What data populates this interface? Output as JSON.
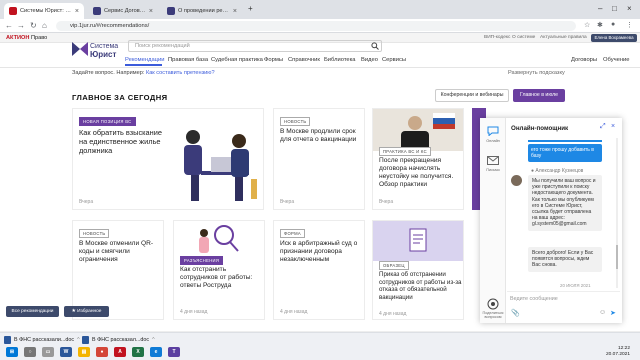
{
  "browser": {
    "tabs": [
      {
        "title": "Системы Юрист: ВИП-кодекс",
        "color": "#c1121f"
      },
      {
        "title": "Сервис Договоры",
        "color": "#3b3b7a"
      },
      {
        "title": "О проведении реки ерундиг...",
        "color": "#3b3b7a"
      }
    ],
    "url": "vip.1jur.ru/#/recommendations/"
  },
  "site_strip": {
    "logo_red": "АКТИОН",
    "logo_dark": "Право",
    "links": [
      "ВИП-кодекс",
      "О системе",
      "Актуальные правила"
    ],
    "account_button": "Елена Вохрамеева"
  },
  "header": {
    "logo_line1": "Система",
    "logo_line2": "Юрист",
    "search_placeholder": "Поиск рекомендаций",
    "menu": [
      "Рекомендации",
      "Правовая база",
      "Судебная практика",
      "Формы",
      "Справочник",
      "Библиотека",
      "Видео",
      "Сервисы"
    ],
    "menu_right": [
      "Договоры",
      "Обучение"
    ],
    "ask_prefix": "Задайте вопрос. Например:",
    "ask_link": "Как составить претензию?",
    "expand_hint": "Развернуть подсказку"
  },
  "main": {
    "heading": "ГЛАВНОЕ ЗА СЕГОДНЯ",
    "btn_conferences": "Конференции и вебинары",
    "btn_main_july": "Главное в июле",
    "cards": [
      {
        "tag": "НОВАЯ ПОЗИЦИЯ ВС",
        "title": "Как обратить взыскание на единственное жилье должника",
        "date": "Вчера"
      },
      {
        "tag": "НОВОСТЬ",
        "title": "В Москве продлили срок для отчета о вакцинации",
        "date": "Вчера"
      },
      {
        "tag": "ПРАКТИКА ВС И КС",
        "title": "После прекращения договора начислять неустойку не получится. Обзор практики",
        "date": "Вчера"
      },
      {
        "tag": "НОВОСТЬ",
        "title": "В Москве отменили QR-коды и смягчили ограничения",
        "date": ""
      },
      {
        "tag": "РАЗЪЯСНЕНИЯ",
        "title": "Как отстранить сотрудников от работы: ответы Роструда",
        "date": "4 дня назад"
      },
      {
        "tag": "ФОРМА",
        "title": "Иск в арбитражный суд о признании договора незаключенным",
        "date": "4 дня назад"
      },
      {
        "tag": "ОБРАЗЕЦ",
        "title": "Приказ об отстранении сотрудников от работы из-за отказа от обязательной вакцинации",
        "date": "4 дня назад"
      }
    ],
    "btn_recommendations": "Все рекомендации",
    "btn_favorites": "Избранное"
  },
  "chat": {
    "title": "Онлайн-помощник",
    "side_labels": [
      "Онлайн",
      "Письмо",
      "Поделиться вопросом"
    ],
    "user_message": "его тоже прошу добавить в базу",
    "operator_name": "Александр Кузнецов",
    "operator_message": "Мы получили ваш вопрос и уже приступили к поиску недостающего документа. Как только мы опубликуем его в Системе Юрист, ссылка будет отправлена на ваш адрес: gl.system05@gmail.com",
    "operator_message2": "Всего доброго! Если у Вас появятся вопросы, ждем Вас снова.",
    "date": "20 ИЮЛЯ 2021",
    "input_placeholder": "Ведите сообщение"
  },
  "taskbar": {
    "downloads": [
      "В ФНС рассказали...doc",
      "В ФНС рассказал...doc"
    ],
    "time": "12:22",
    "date": "20.07.2021"
  },
  "colors": {
    "accent": "#6a3fa0",
    "link": "#3b5bdb",
    "chat_blue": "#1e88e5"
  }
}
